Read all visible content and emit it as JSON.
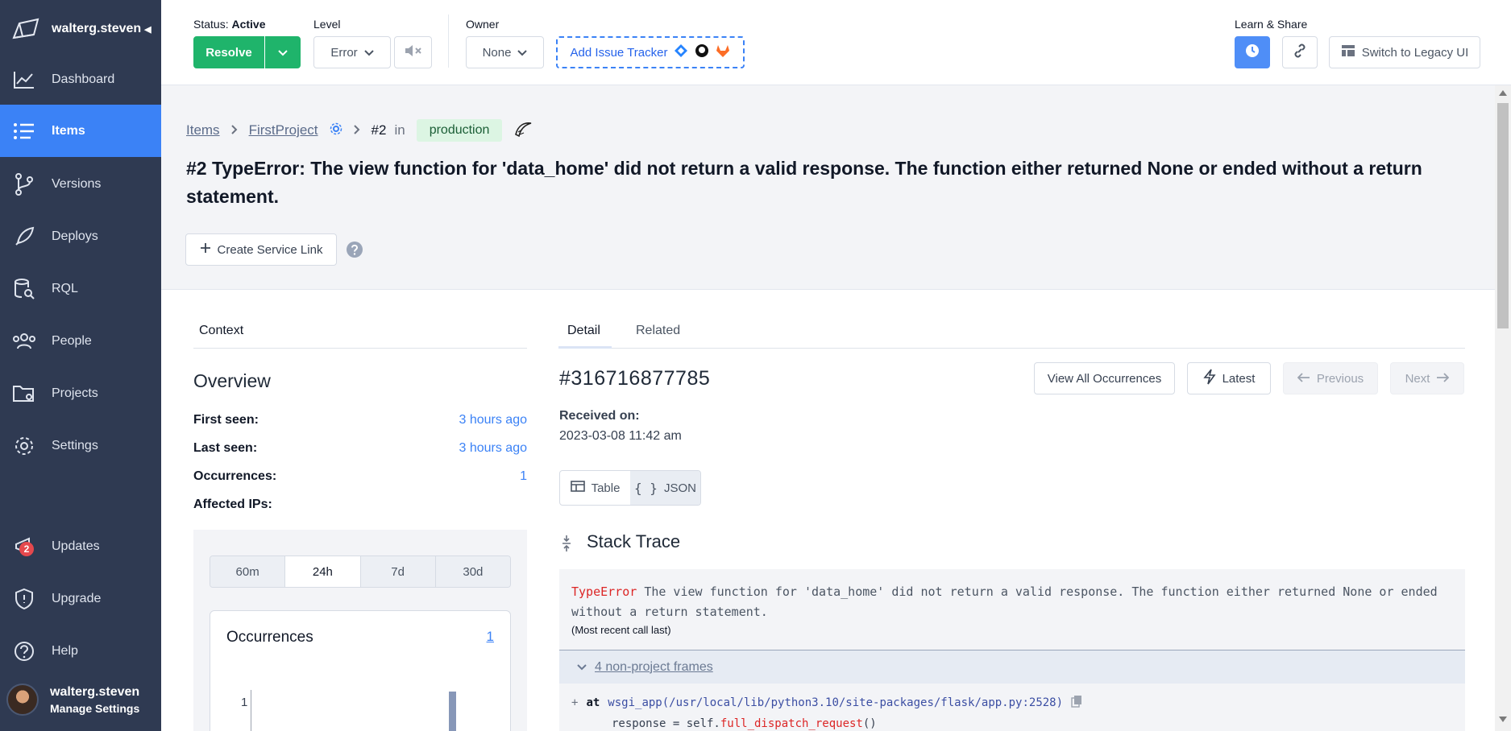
{
  "sidebar": {
    "account": "walterg.steven",
    "items": [
      {
        "label": "Dashboard",
        "icon": "chart-line-icon"
      },
      {
        "label": "Items",
        "icon": "list-icon"
      },
      {
        "label": "Versions",
        "icon": "git-branch-icon"
      },
      {
        "label": "Deploys",
        "icon": "rocket-icon"
      },
      {
        "label": "RQL",
        "icon": "database-search-icon"
      },
      {
        "label": "People",
        "icon": "people-icon"
      },
      {
        "label": "Projects",
        "icon": "folder-gear-icon"
      },
      {
        "label": "Settings",
        "icon": "gear-icon"
      },
      {
        "label": "Updates",
        "icon": "megaphone-icon",
        "badge": "2"
      },
      {
        "label": "Upgrade",
        "icon": "shield-icon"
      },
      {
        "label": "Help",
        "icon": "help-icon"
      }
    ],
    "user": {
      "name": "walterg.steven",
      "sub": "Manage Settings"
    }
  },
  "topbar": {
    "status_label": "Status:",
    "status_value": "Active",
    "resolve": "Resolve",
    "level_label": "Level",
    "level_value": "Error",
    "owner_label": "Owner",
    "owner_value": "None",
    "issue_tracker": "Add Issue Tracker",
    "learn_label": "Learn & Share",
    "legacy": "Switch to Legacy UI"
  },
  "header": {
    "crumb_items": "Items",
    "crumb_project": "FirstProject",
    "item_number": "#2",
    "in_text": "in",
    "environment": "production",
    "title": "#2 TypeError: The view function for 'data_home' did not return a valid response. The function either returned None or ended without a return statement.",
    "service_link": "Create Service Link"
  },
  "context": {
    "tab": "Context",
    "overview": "Overview",
    "rows": [
      {
        "k": "First seen:",
        "v": "3 hours ago"
      },
      {
        "k": "Last seen:",
        "v": "3 hours ago"
      },
      {
        "k": "Occurrences:",
        "v": "1"
      },
      {
        "k": "Affected IPs:",
        "v": ""
      }
    ],
    "ranges": [
      "60m",
      "24h",
      "7d",
      "30d"
    ],
    "selected_range": "24h",
    "occ_title": "Occurrences",
    "occ_count": "1",
    "chart_tick": "1"
  },
  "detail": {
    "tabs": [
      "Detail",
      "Related"
    ],
    "occurrence_id": "#316716877785",
    "view_all": "View All Occurrences",
    "latest": "Latest",
    "previous": "Previous",
    "next": "Next",
    "received_label": "Received on:",
    "received_value": "2023-03-08 11:42 am",
    "view_table": "Table",
    "view_json": "JSON",
    "stack_title": "Stack Trace",
    "error_type": "TypeError",
    "error_msg": "The view function for 'data_home' did not return a valid response. The function either returned None or ended without a return statement.",
    "call_order": "(Most recent call last)",
    "frames_toggle": "4 non-project frames",
    "frame_at": "at",
    "frame_func": "wsgi_app",
    "frame_path": "(/usr/local/lib/python3.10/site-packages/flask/app.py:2528)",
    "code_prefix": "response = self.",
    "code_fn": "full_dispatch_request",
    "code_suffix": "()"
  },
  "colors": {
    "sidebar": "#2f3a52",
    "accent": "#3b82f6",
    "resolve": "#1fb46b",
    "error": "#dc2626"
  }
}
